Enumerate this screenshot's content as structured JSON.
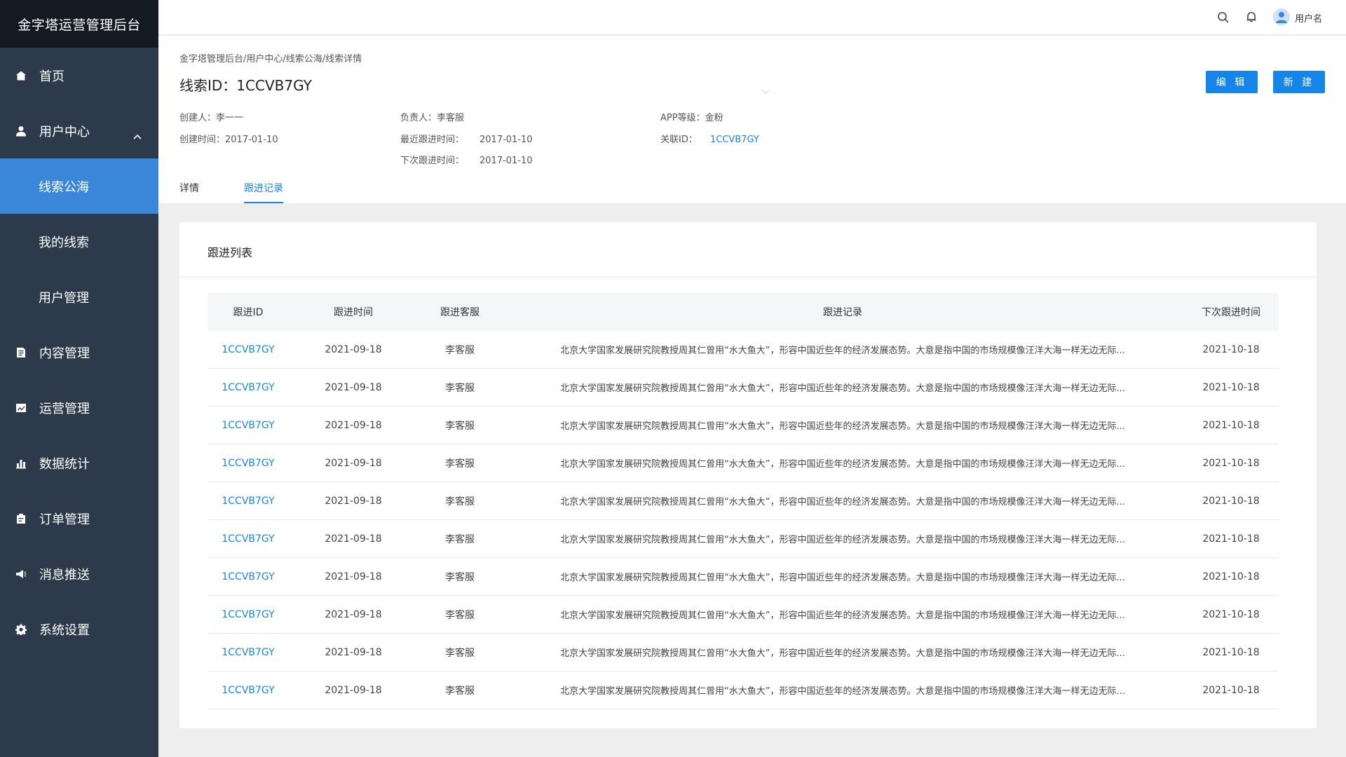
{
  "app": {
    "title": "金字塔运营管理后台"
  },
  "sidebar": {
    "items": [
      {
        "label": "首页",
        "icon": "home-icon"
      },
      {
        "label": "用户中心",
        "icon": "user-icon",
        "expanded": true
      },
      {
        "label": "内容管理",
        "icon": "document-icon"
      },
      {
        "label": "运营管理",
        "icon": "chart-line-icon"
      },
      {
        "label": "数据统计",
        "icon": "bar-chart-icon"
      },
      {
        "label": "订单管理",
        "icon": "clipboard-icon"
      },
      {
        "label": "消息推送",
        "icon": "megaphone-icon"
      },
      {
        "label": "系统设置",
        "icon": "gear-icon"
      }
    ],
    "subitems": [
      {
        "label": "线索公海",
        "active": true
      },
      {
        "label": "我的线索"
      },
      {
        "label": "用户管理"
      }
    ]
  },
  "topbar": {
    "username": "用户名",
    "icons": [
      "search-icon",
      "bell-icon",
      "avatar"
    ]
  },
  "header": {
    "breadcrumb": "金字塔管理后台/用户中心/线索公海/线索详情",
    "title": "线索ID：1CCVB7GY",
    "edit_label": "编 辑",
    "new_label": "新 建"
  },
  "info": {
    "creator_label": "创建人：",
    "creator": "李一一",
    "created_time_label": "创建时间：",
    "created_time": "2017-01-10",
    "owner_label": "负责人：",
    "owner": "李客服",
    "last_followup_label": "最近跟进时间：",
    "last_followup": "2017-01-10",
    "next_followup_label": "下次跟进时间：",
    "next_followup": "2017-01-10",
    "app_level_label": "APP等级：",
    "app_level": "金粉",
    "related_id_label": "关联ID：",
    "related_id": "1CCVB7GY"
  },
  "tabs": [
    {
      "label": "详情",
      "active": false
    },
    {
      "label": "跟进记录",
      "active": true
    }
  ],
  "card": {
    "title": "跟进列表"
  },
  "table": {
    "columns": [
      "跟进ID",
      "跟进时间",
      "跟进客服",
      "跟进记录",
      "下次跟进时间"
    ],
    "rows": [
      {
        "id": "1CCVB7GY",
        "time": "2021-09-18",
        "agent": "李客服",
        "record": "北京大学国家发展研究院教授周其仁曾用“水大鱼大”，形容中国近些年的经济发展态势。大意是指中国的市场规模像汪洋大海一样无边无际...",
        "next": "2021-10-18"
      },
      {
        "id": "1CCVB7GY",
        "time": "2021-09-18",
        "agent": "李客服",
        "record": "北京大学国家发展研究院教授周其仁曾用“水大鱼大”，形容中国近些年的经济发展态势。大意是指中国的市场规模像汪洋大海一样无边无际...",
        "next": "2021-10-18"
      },
      {
        "id": "1CCVB7GY",
        "time": "2021-09-18",
        "agent": "李客服",
        "record": "北京大学国家发展研究院教授周其仁曾用“水大鱼大”，形容中国近些年的经济发展态势。大意是指中国的市场规模像汪洋大海一样无边无际...",
        "next": "2021-10-18"
      },
      {
        "id": "1CCVB7GY",
        "time": "2021-09-18",
        "agent": "李客服",
        "record": "北京大学国家发展研究院教授周其仁曾用“水大鱼大”，形容中国近些年的经济发展态势。大意是指中国的市场规模像汪洋大海一样无边无际...",
        "next": "2021-10-18"
      },
      {
        "id": "1CCVB7GY",
        "time": "2021-09-18",
        "agent": "李客服",
        "record": "北京大学国家发展研究院教授周其仁曾用“水大鱼大”，形容中国近些年的经济发展态势。大意是指中国的市场规模像汪洋大海一样无边无际...",
        "next": "2021-10-18"
      },
      {
        "id": "1CCVB7GY",
        "time": "2021-09-18",
        "agent": "李客服",
        "record": "北京大学国家发展研究院教授周其仁曾用“水大鱼大”，形容中国近些年的经济发展态势。大意是指中国的市场规模像汪洋大海一样无边无际...",
        "next": "2021-10-18"
      },
      {
        "id": "1CCVB7GY",
        "time": "2021-09-18",
        "agent": "李客服",
        "record": "北京大学国家发展研究院教授周其仁曾用“水大鱼大”，形容中国近些年的经济发展态势。大意是指中国的市场规模像汪洋大海一样无边无际...",
        "next": "2021-10-18"
      },
      {
        "id": "1CCVB7GY",
        "time": "2021-09-18",
        "agent": "李客服",
        "record": "北京大学国家发展研究院教授周其仁曾用“水大鱼大”，形容中国近些年的经济发展态势。大意是指中国的市场规模像汪洋大海一样无边无际...",
        "next": "2021-10-18"
      },
      {
        "id": "1CCVB7GY",
        "time": "2021-09-18",
        "agent": "李客服",
        "record": "北京大学国家发展研究院教授周其仁曾用“水大鱼大”，形容中国近些年的经济发展态势。大意是指中国的市场规模像汪洋大海一样无边无际...",
        "next": "2021-10-18"
      },
      {
        "id": "1CCVB7GY",
        "time": "2021-09-18",
        "agent": "李客服",
        "record": "北京大学国家发展研究院教授周其仁曾用“水大鱼大”，形容中国近些年的经济发展态势。大意是指中国的市场规模像汪洋大海一样无边无际...",
        "next": "2021-10-18"
      }
    ]
  },
  "colors": {
    "sidebar_bg": "#2d3a4b",
    "brand_bg": "#141a22",
    "active_item": "#3a87d9",
    "accent": "#1585ea",
    "page_bg": "#eeeeee"
  }
}
